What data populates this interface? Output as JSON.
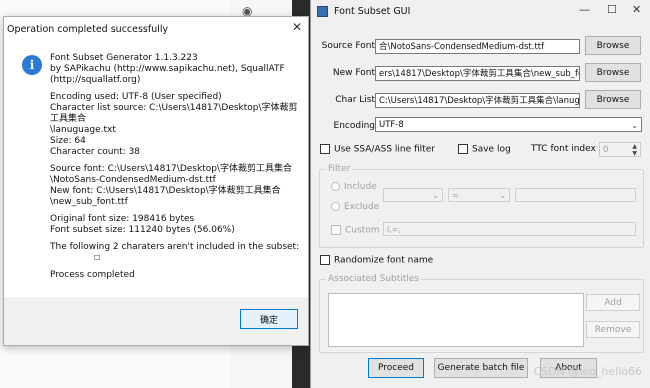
{
  "msgbox": {
    "title": "Operation completed successfully",
    "lines": [
      "Font Subset Generator 1.1.3.223",
      "by SAPikachu (http://www.sapikachu.net), SquallATF",
      "(http://squallatf.org)",
      "",
      "Encoding used: UTF-8 (User specified)",
      "Character list source: C:\\Users\\14817\\Desktop\\字体裁剪工具集合",
      "\\lanuguage.txt",
      "Size: 64",
      "Character count: 38",
      "",
      "Source font: C:\\Users\\14817\\Desktop\\字体裁剪工具集合",
      "\\NotoSans-CondensedMedium-dst.ttf",
      "New font: C:\\Users\\14817\\Desktop\\字体裁剪工具集合\\new_sub_font.ttf",
      "",
      "Original font size: 198416 bytes",
      "Font subset size: 111240 bytes (56.06%)",
      "",
      "The following 2 charaters aren't included in the subset:",
      "​         ",
      "",
      "Process completed"
    ],
    "missing_chars": "         ​    ",
    "ok_label": "确定"
  },
  "gui": {
    "title": "Font Subset GUI",
    "source_font_label": "Source Font",
    "source_font_value": "合\\NotoSans-CondensedMedium-dst.ttf",
    "source_font_value_full": "C:\\Users\\14817\\Desktop\\字体裁剪工具集合\\NotoSans-CondensedMedium-dst.ttf",
    "new_font_label": "New Font",
    "new_font_value": "ers\\14817\\Desktop\\字体裁剪工具集合\\new_sub_font.ttf",
    "char_list_label": "Char List",
    "char_list_value": "C:\\Users\\14817\\Desktop\\字体裁剪工具集合\\lanuguage",
    "browse_label": "Browse",
    "encoding_label": "Encoding",
    "encoding_value": "UTF-8",
    "use_ssa_label": "Use SSA/ASS line filter",
    "save_log_label": "Save log",
    "ttc_index_label": "TTC font index",
    "ttc_index_value": "0",
    "filter_legend": "Filter",
    "include_label": "Include",
    "exclude_label": "Exclude",
    "custom_label": "Custom",
    "filter_op_value": "=",
    "custom_value": "i,=,",
    "randomize_label": "Randomize font name",
    "assoc_legend": "Associated Subtitles",
    "add_label": "Add",
    "remove_label": "Remove",
    "proceed_label": "Proceed",
    "batch_label": "Generate batch file",
    "about_label": "About"
  },
  "watermark": "CSDN @leo_hello66",
  "colors": {
    "accent": "#0078d4",
    "info_icon": "#2a7ad6"
  }
}
